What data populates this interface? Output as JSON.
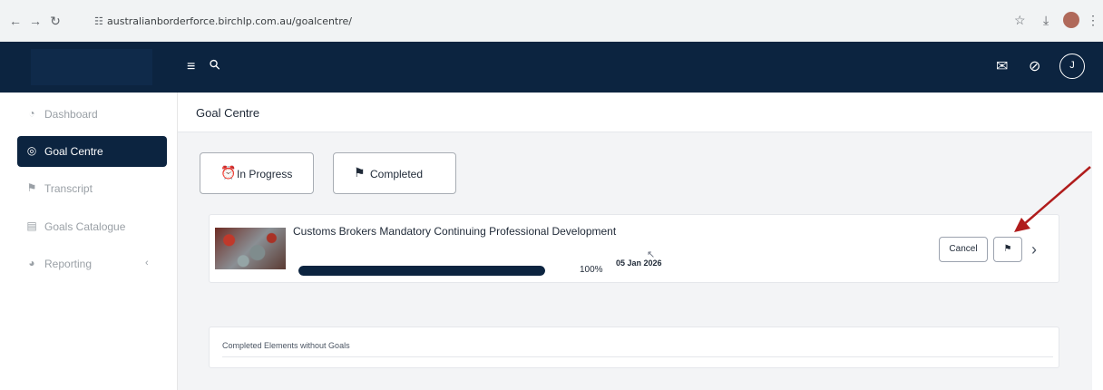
{
  "browser": {
    "url": "australianborderforce.birchlp.com.au/goalcentre/",
    "back_icon": "←",
    "forward_icon": "→",
    "reload_icon": "↻",
    "star_icon": "☆",
    "download_icon": "⤓",
    "menu_icon": "⋮",
    "site_icon": "☷"
  },
  "header": {
    "menu_icon": "≡",
    "search_icon": "⚲",
    "megaphone_icon": "✉",
    "bell_off_icon": "⊘",
    "avatar_initial": "J"
  },
  "sidebar": {
    "items": [
      {
        "label": "Dashboard",
        "icon": "◔"
      },
      {
        "label": "Goal Centre",
        "icon": "◎"
      },
      {
        "label": "Transcript",
        "icon": "⚑"
      },
      {
        "label": "Goals Catalogue",
        "icon": "▤"
      },
      {
        "label": "Reporting",
        "icon": "◕",
        "chevron": "‹"
      }
    ]
  },
  "main": {
    "title": "Goal Centre",
    "tabs": [
      {
        "label": "In Progress",
        "icon": "⏰"
      },
      {
        "label": "Completed",
        "icon": "⚑"
      }
    ],
    "goal": {
      "title": "Customs Brokers Mandatory Continuing Professional Development",
      "progress": 1.0,
      "progress_label": "100%",
      "date": "05 Jan 2026",
      "cancel_label": "Cancel",
      "flag_icon": "⚑",
      "chevron_icon": "›",
      "cursor_icon": "↖"
    },
    "completed_section": {
      "label": "Completed Elements without Goals"
    }
  },
  "colors": {
    "navy": "#0c2440",
    "annotation_arrow": "#b01c1c"
  }
}
